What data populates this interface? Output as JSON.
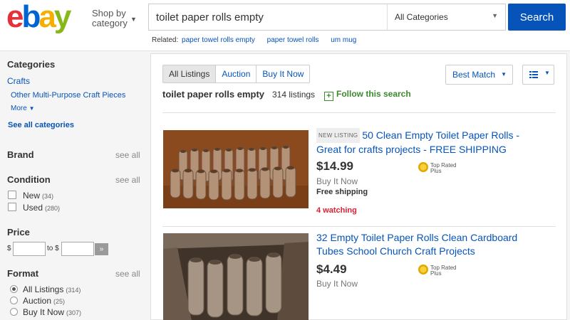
{
  "header": {
    "logo_letters": [
      {
        "char": "e",
        "color": "#e53238"
      },
      {
        "char": "b",
        "color": "#0064d2"
      },
      {
        "char": "a",
        "color": "#f5af02"
      },
      {
        "char": "y",
        "color": "#86b817"
      }
    ],
    "shop_by_line1": "Shop by",
    "shop_by_line2": "category",
    "search_value": "toilet paper rolls empty",
    "category_select": "All Categories",
    "search_button": "Search",
    "related_label": "Related:",
    "related_links": [
      "paper towel rolls empty",
      "paper towel rolls",
      "um mug"
    ]
  },
  "sidebar": {
    "categories_heading": "Categories",
    "category_current": "Crafts",
    "category_sub": "Other Multi-Purpose Craft Pieces",
    "more_label": "More",
    "see_all_categories": "See all categories",
    "brand_heading": "Brand",
    "see_all": "see all",
    "condition_heading": "Condition",
    "condition_options": [
      {
        "label": "New",
        "count": "(34)"
      },
      {
        "label": "Used",
        "count": "(280)"
      }
    ],
    "price_heading": "Price",
    "price_currency": "$",
    "price_to": "to $",
    "format_heading": "Format",
    "format_options": [
      {
        "label": "All Listings",
        "count": "(314)",
        "selected": true
      },
      {
        "label": "Auction",
        "count": "(25)",
        "selected": false
      },
      {
        "label": "Buy It Now",
        "count": "(307)",
        "selected": false
      }
    ]
  },
  "main": {
    "tabs": [
      "All Listings",
      "Auction",
      "Buy It Now"
    ],
    "sort_label": "Best Match",
    "query_title": "toilet paper rolls empty",
    "listing_count": "314 listings",
    "follow_label": "Follow this search",
    "items": [
      {
        "badge": "NEW LISTING",
        "title": "50 Clean Empty Toilet Paper Rolls - Great for crafts projects - FREE SHIPPING",
        "price": "$14.99",
        "format": "Buy It Now",
        "shipping": "Free shipping",
        "watching": "4 watching",
        "top_rated": [
          "Top Rated",
          "Plus"
        ]
      },
      {
        "badge": "",
        "title": "32 Empty Toilet Paper Rolls Clean Cardboard Tubes School Church Craft Projects",
        "price": "$4.49",
        "format": "Buy It Now",
        "shipping": "",
        "watching": "",
        "top_rated": [
          "Top Rated",
          "Plus"
        ]
      }
    ]
  },
  "colors": {
    "link": "#0654ba",
    "search_button": "#0654ba",
    "follow_green": "#3c8a2e",
    "watching_red": "#dd1e31"
  }
}
